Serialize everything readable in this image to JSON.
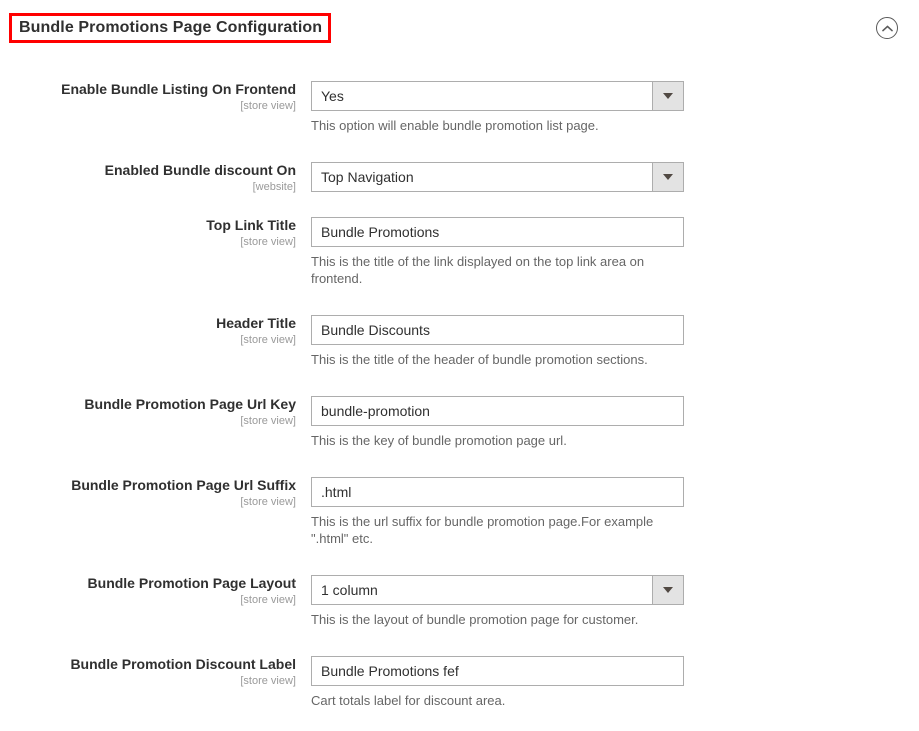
{
  "section": {
    "title": "Bundle Promotions Page Configuration",
    "highlight_color": "#ff0000",
    "collapse_icon": "chevron-up-circle-icon"
  },
  "fields": [
    {
      "label": "Enable Bundle Listing On Frontend",
      "scope": "[store view]",
      "type": "select",
      "value": "Yes",
      "help": "This option will enable bundle promotion list page."
    },
    {
      "label": "Enabled Bundle discount On",
      "scope": "[website]",
      "type": "select",
      "value": "Top Navigation",
      "help": ""
    },
    {
      "label": "Top Link Title",
      "scope": "[store view]",
      "type": "text",
      "value": "Bundle Promotions",
      "help": "This is the title of the link displayed on the top link area on frontend."
    },
    {
      "label": "Header Title",
      "scope": "[store view]",
      "type": "text",
      "value": "Bundle Discounts",
      "help": "This is the title of the header of bundle promotion sections."
    },
    {
      "label": "Bundle Promotion Page Url Key",
      "scope": "[store view]",
      "type": "text",
      "value": "bundle-promotion",
      "help": "This is the key of bundle promotion page url."
    },
    {
      "label": "Bundle Promotion Page Url Suffix",
      "scope": "[store view]",
      "type": "text",
      "value": ".html",
      "help": "This is the url suffix for bundle promotion page.For example \".html\" etc."
    },
    {
      "label": "Bundle Promotion Page Layout",
      "scope": "[store view]",
      "type": "select",
      "value": "1 column",
      "help": "This is the layout of bundle promotion page for customer."
    },
    {
      "label": "Bundle Promotion Discount Label",
      "scope": "[store view]",
      "type": "text",
      "value": "Bundle Promotions fef",
      "help": "Cart totals label for discount area."
    }
  ]
}
